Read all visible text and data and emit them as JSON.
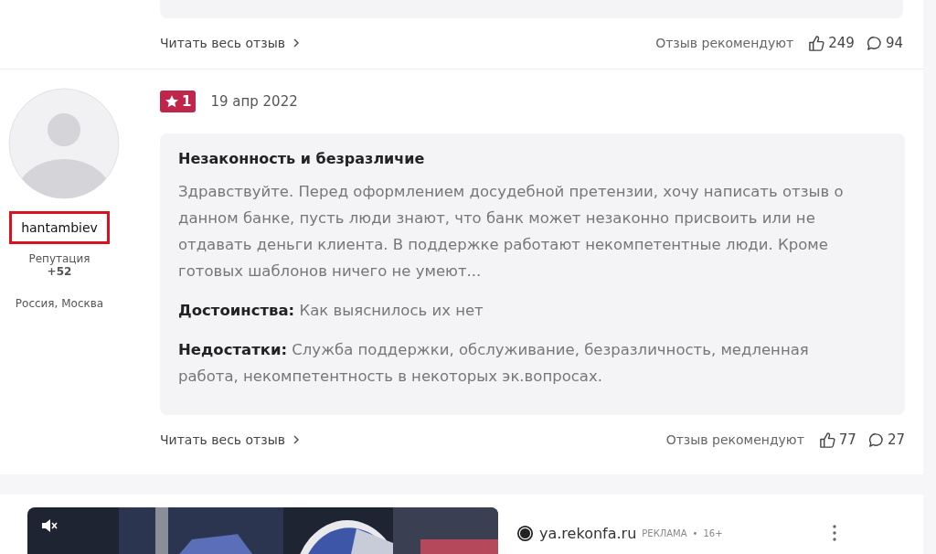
{
  "previous_review": {
    "read_more": "Читать весь отзыв",
    "recommend_label": "Отзыв рекомендуют",
    "likes": "249",
    "comments": "94"
  },
  "review": {
    "user": {
      "name": "hantambiev",
      "highlighted": true,
      "reputation_label": "Репутация",
      "reputation": "+52",
      "location": "Россия, Москва"
    },
    "rating": "1",
    "date": "19 апр 2022",
    "title": "Незаконность и безразличие",
    "text": "Здравствуйте. Перед оформлением досудебной претензии, хочу написать отзыв о данном банке, пусть люди знают, что банк может незаконно присвоить или не отдавать деньги клиента. В поддержке работают некомпетентные люди. Кроме готовых шаблонов ничего не умеют...",
    "pros": "**Достоинства:** Как выяснилось их нет",
    "cons": "**Недостатки:** Служба поддержки, обслуживание, безразличность, медленная работа, некомпетентность в некоторых эк.вопросах.",
    "read_more": "Читать весь отзыв",
    "recommend_label": "Отзыв рекомендуют",
    "likes": "77",
    "comments": "27"
  },
  "ad": {
    "kind": "picture",
    "muted": true,
    "source": "ya.rekonfa.ru",
    "label": "РЕКЛАМА",
    "separator": "•",
    "age": "16+"
  }
}
